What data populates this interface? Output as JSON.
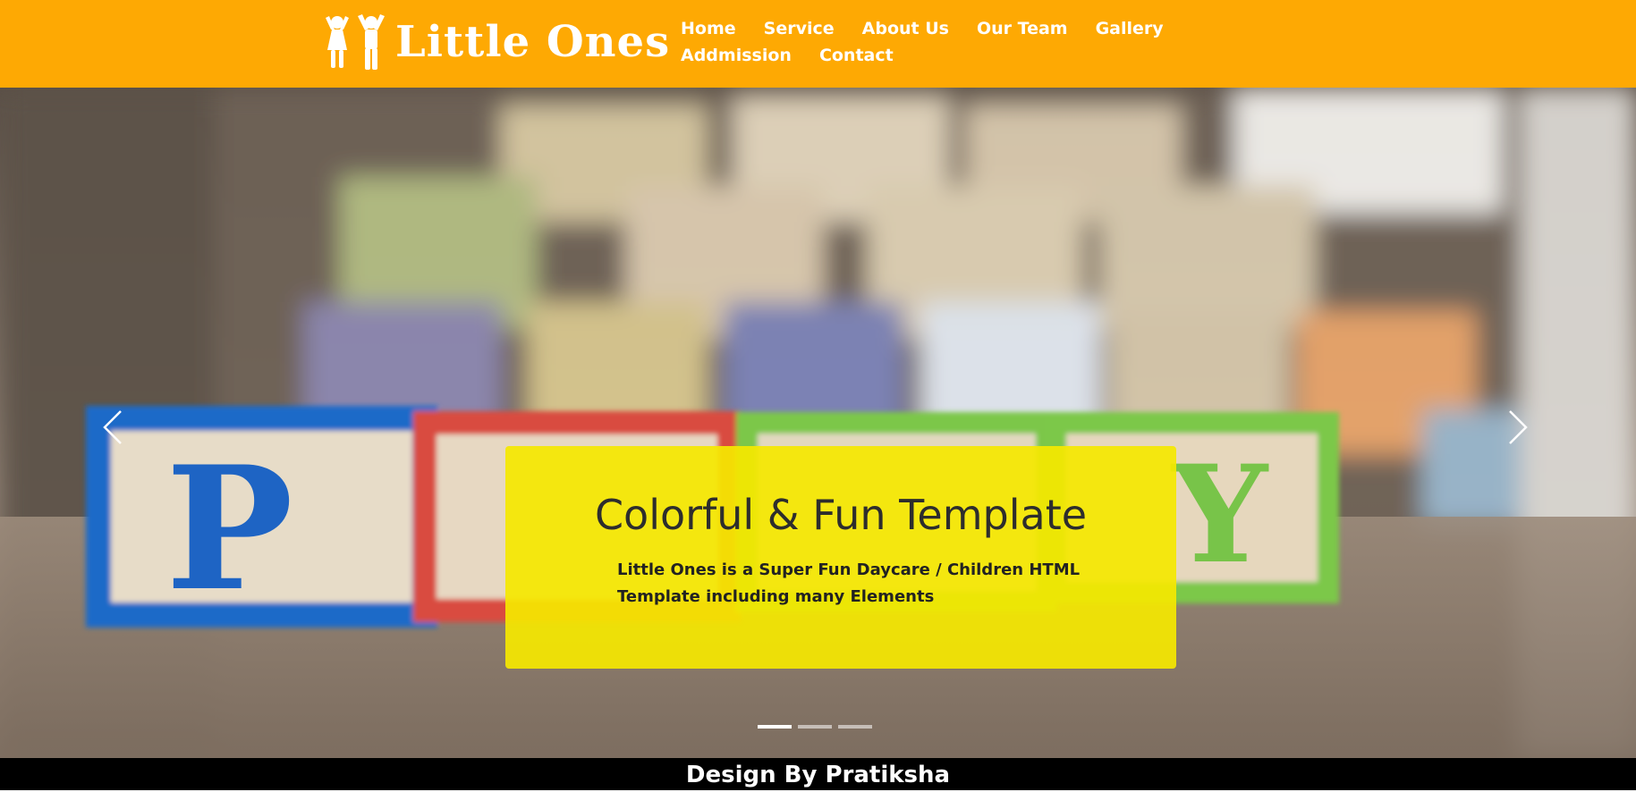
{
  "brand": {
    "name": "Little Ones",
    "logo_icon": "children-icon",
    "header_color": "#fea903"
  },
  "nav": {
    "items": [
      {
        "label": "Home"
      },
      {
        "label": "Service"
      },
      {
        "label": "About Us"
      },
      {
        "label": "Our Team"
      },
      {
        "label": "Gallery"
      },
      {
        "label": "Addmission"
      },
      {
        "label": "Contact"
      }
    ]
  },
  "hero": {
    "caption_title": "Colorful & Fun Template",
    "caption_text": "Little Ones is a Super Fun Daycare / Children HTML Template including many Elements",
    "caption_color": "#f5e800",
    "prev_icon": "chevron-left-icon",
    "next_icon": "chevron-right-icon",
    "slide_count": 3,
    "active_slide": 1
  },
  "footer": {
    "text": "Design By Pratiksha"
  }
}
